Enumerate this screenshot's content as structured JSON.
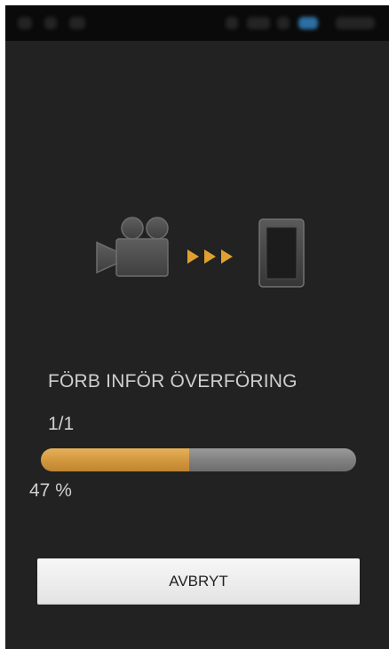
{
  "status_bar": {
    "icons": [
      "notification-icon",
      "wifi-icon",
      "bluetooth-icon",
      "battery-icon"
    ],
    "accent": "#2c6fa3"
  },
  "graphic": {
    "source_icon": "video-camera-icon",
    "arrow_icon": "triple-arrow-icon",
    "target_icon": "smartphone-icon",
    "arrow_color": "#e0a030"
  },
  "transfer": {
    "status_label": "FÖRB INFÖR ÖVERFÖRING",
    "file_counter": "1/1",
    "progress_fraction": 0.47,
    "progress_text": "47 %",
    "progress_color": "#d39a3e"
  },
  "actions": {
    "cancel_label": "AVBRYT"
  }
}
